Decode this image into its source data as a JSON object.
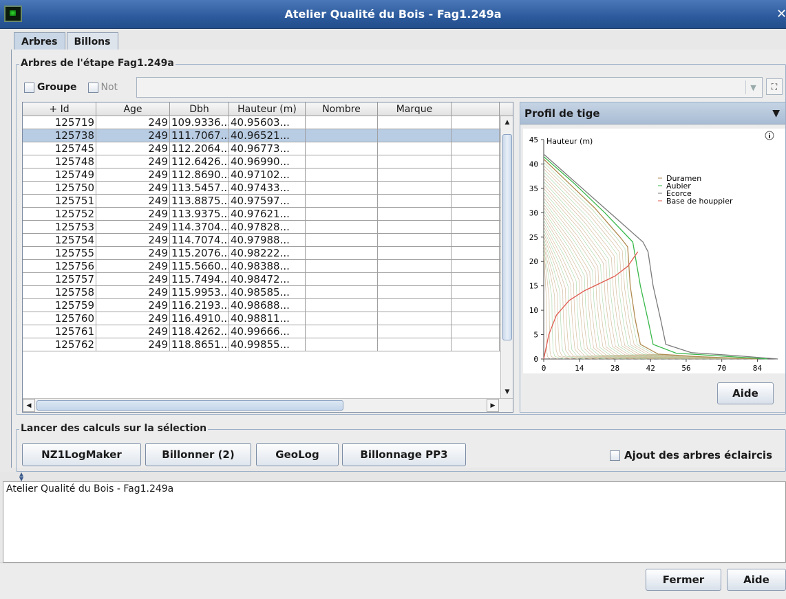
{
  "window": {
    "title": "Atelier Qualité du Bois - Fag1.249a",
    "close_glyph": "✕"
  },
  "tabs": [
    {
      "label": "Arbres",
      "active": true
    },
    {
      "label": "Billons",
      "active": false
    }
  ],
  "trees_group": {
    "title": "Arbres de l'étape Fag1.249a"
  },
  "filter": {
    "groupe_label": "Groupe",
    "not_label": "Not",
    "combo_value": ""
  },
  "table": {
    "columns": [
      "+ Id",
      "Age",
      "Dbh",
      "Hauteur (m)",
      "Nombre",
      "Marque",
      ""
    ],
    "rows": [
      [
        "125719",
        "249",
        "109.9336...",
        "40.95603..."
      ],
      [
        "125738",
        "249",
        "111.7067...",
        "40.96521..."
      ],
      [
        "125745",
        "249",
        "112.2064...",
        "40.96773..."
      ],
      [
        "125748",
        "249",
        "112.6426...",
        "40.96990..."
      ],
      [
        "125749",
        "249",
        "112.8690...",
        "40.97102..."
      ],
      [
        "125750",
        "249",
        "113.5457...",
        "40.97433..."
      ],
      [
        "125751",
        "249",
        "113.8875...",
        "40.97597..."
      ],
      [
        "125752",
        "249",
        "113.9375...",
        "40.97621..."
      ],
      [
        "125753",
        "249",
        "114.3704...",
        "40.97828..."
      ],
      [
        "125754",
        "249",
        "114.7074...",
        "40.97988..."
      ],
      [
        "125755",
        "249",
        "115.2076...",
        "40.98222..."
      ],
      [
        "125756",
        "249",
        "115.5660...",
        "40.98388..."
      ],
      [
        "125757",
        "249",
        "115.7494...",
        "40.98472..."
      ],
      [
        "125758",
        "249",
        "115.9953...",
        "40.98585..."
      ],
      [
        "125759",
        "249",
        "116.2193...",
        "40.98688..."
      ],
      [
        "125760",
        "249",
        "116.4910...",
        "40.98811..."
      ],
      [
        "125761",
        "249",
        "118.4262...",
        "40.99666..."
      ],
      [
        "125762",
        "249",
        "118.8651...",
        "40.99855..."
      ]
    ],
    "selected_row": 1
  },
  "chart_panel": {
    "selector_value": "Profil de tige",
    "aide_label": "Aide"
  },
  "chart_data": {
    "type": "line",
    "ylabel": "Hauteur (m)",
    "xticks": [
      0,
      14,
      28,
      42,
      56,
      70,
      84
    ],
    "yticks": [
      0,
      5,
      10,
      15,
      20,
      25,
      30,
      35,
      40,
      45
    ],
    "xlim": [
      0,
      92
    ],
    "ylim": [
      0,
      45
    ],
    "legend_position": "top-right",
    "series": [
      {
        "name": "Duramen",
        "color": "#b08a50",
        "points": [
          [
            0,
            41
          ],
          [
            10,
            36
          ],
          [
            20,
            31
          ],
          [
            30,
            25
          ],
          [
            33,
            23
          ],
          [
            34,
            15
          ],
          [
            36,
            8
          ],
          [
            38,
            3
          ],
          [
            45,
            1
          ],
          [
            60,
            0.5
          ],
          [
            84,
            0
          ]
        ]
      },
      {
        "name": "Aubier",
        "color": "#39b84a",
        "points": [
          [
            0,
            41.5
          ],
          [
            12,
            36
          ],
          [
            24,
            30
          ],
          [
            35,
            24
          ],
          [
            36,
            21
          ],
          [
            38,
            15
          ],
          [
            41,
            8
          ],
          [
            43,
            3
          ],
          [
            52,
            1.2
          ],
          [
            70,
            0.6
          ],
          [
            88,
            0
          ]
        ]
      },
      {
        "name": "Ecorce",
        "color": "#7a7a7a",
        "points": [
          [
            0,
            42
          ],
          [
            13,
            36
          ],
          [
            26,
            30
          ],
          [
            39,
            24
          ],
          [
            41,
            22
          ],
          [
            43,
            15
          ],
          [
            46,
            8
          ],
          [
            48,
            3
          ],
          [
            58,
            1.3
          ],
          [
            75,
            0.7
          ],
          [
            92,
            0
          ]
        ]
      },
      {
        "name": "Base de houppier",
        "color": "#e05a50",
        "points": [
          [
            0,
            0
          ],
          [
            2,
            5
          ],
          [
            5,
            9
          ],
          [
            10,
            12
          ],
          [
            16,
            14
          ],
          [
            22,
            15.5
          ],
          [
            28,
            17
          ],
          [
            33,
            19
          ],
          [
            37,
            22
          ]
        ]
      }
    ]
  },
  "actions_group": {
    "title": "Lancer des calculs sur la sélection"
  },
  "actions": {
    "nz1": "NZ1LogMaker",
    "billonner": "Billonner (2)",
    "geolog": "GeoLog",
    "pp3": "Billonnage PP3",
    "ajout_label": "Ajout des arbres éclaircis"
  },
  "log": {
    "text": "Atelier Qualité du Bois - Fag1.249a"
  },
  "footer": {
    "fermer": "Fermer",
    "aide": "Aide"
  }
}
